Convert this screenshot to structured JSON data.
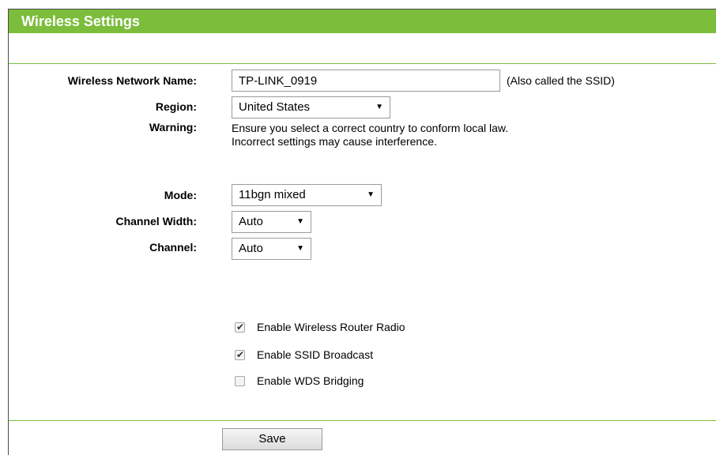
{
  "title": "Wireless Settings",
  "fields": {
    "ssid_label": "Wireless Network Name:",
    "ssid_value": "TP-LINK_0919",
    "ssid_note": "(Also called the SSID)",
    "region_label": "Region:",
    "region_value": "United States",
    "warning_label": "Warning:",
    "warning_line1": "Ensure you select a correct country to conform local law.",
    "warning_line2": "Incorrect settings may cause interference.",
    "mode_label": "Mode:",
    "mode_value": "11bgn mixed",
    "channel_width_label": "Channel Width:",
    "channel_width_value": "Auto",
    "channel_label": "Channel:",
    "channel_value": "Auto"
  },
  "options": [
    {
      "label": "Enable Wireless Router Radio",
      "checked": true
    },
    {
      "label": "Enable SSID Broadcast",
      "checked": true
    },
    {
      "label": "Enable WDS Bridging",
      "checked": false
    }
  ],
  "save_label": "Save",
  "colors": {
    "accent": "#7cbd3c"
  }
}
